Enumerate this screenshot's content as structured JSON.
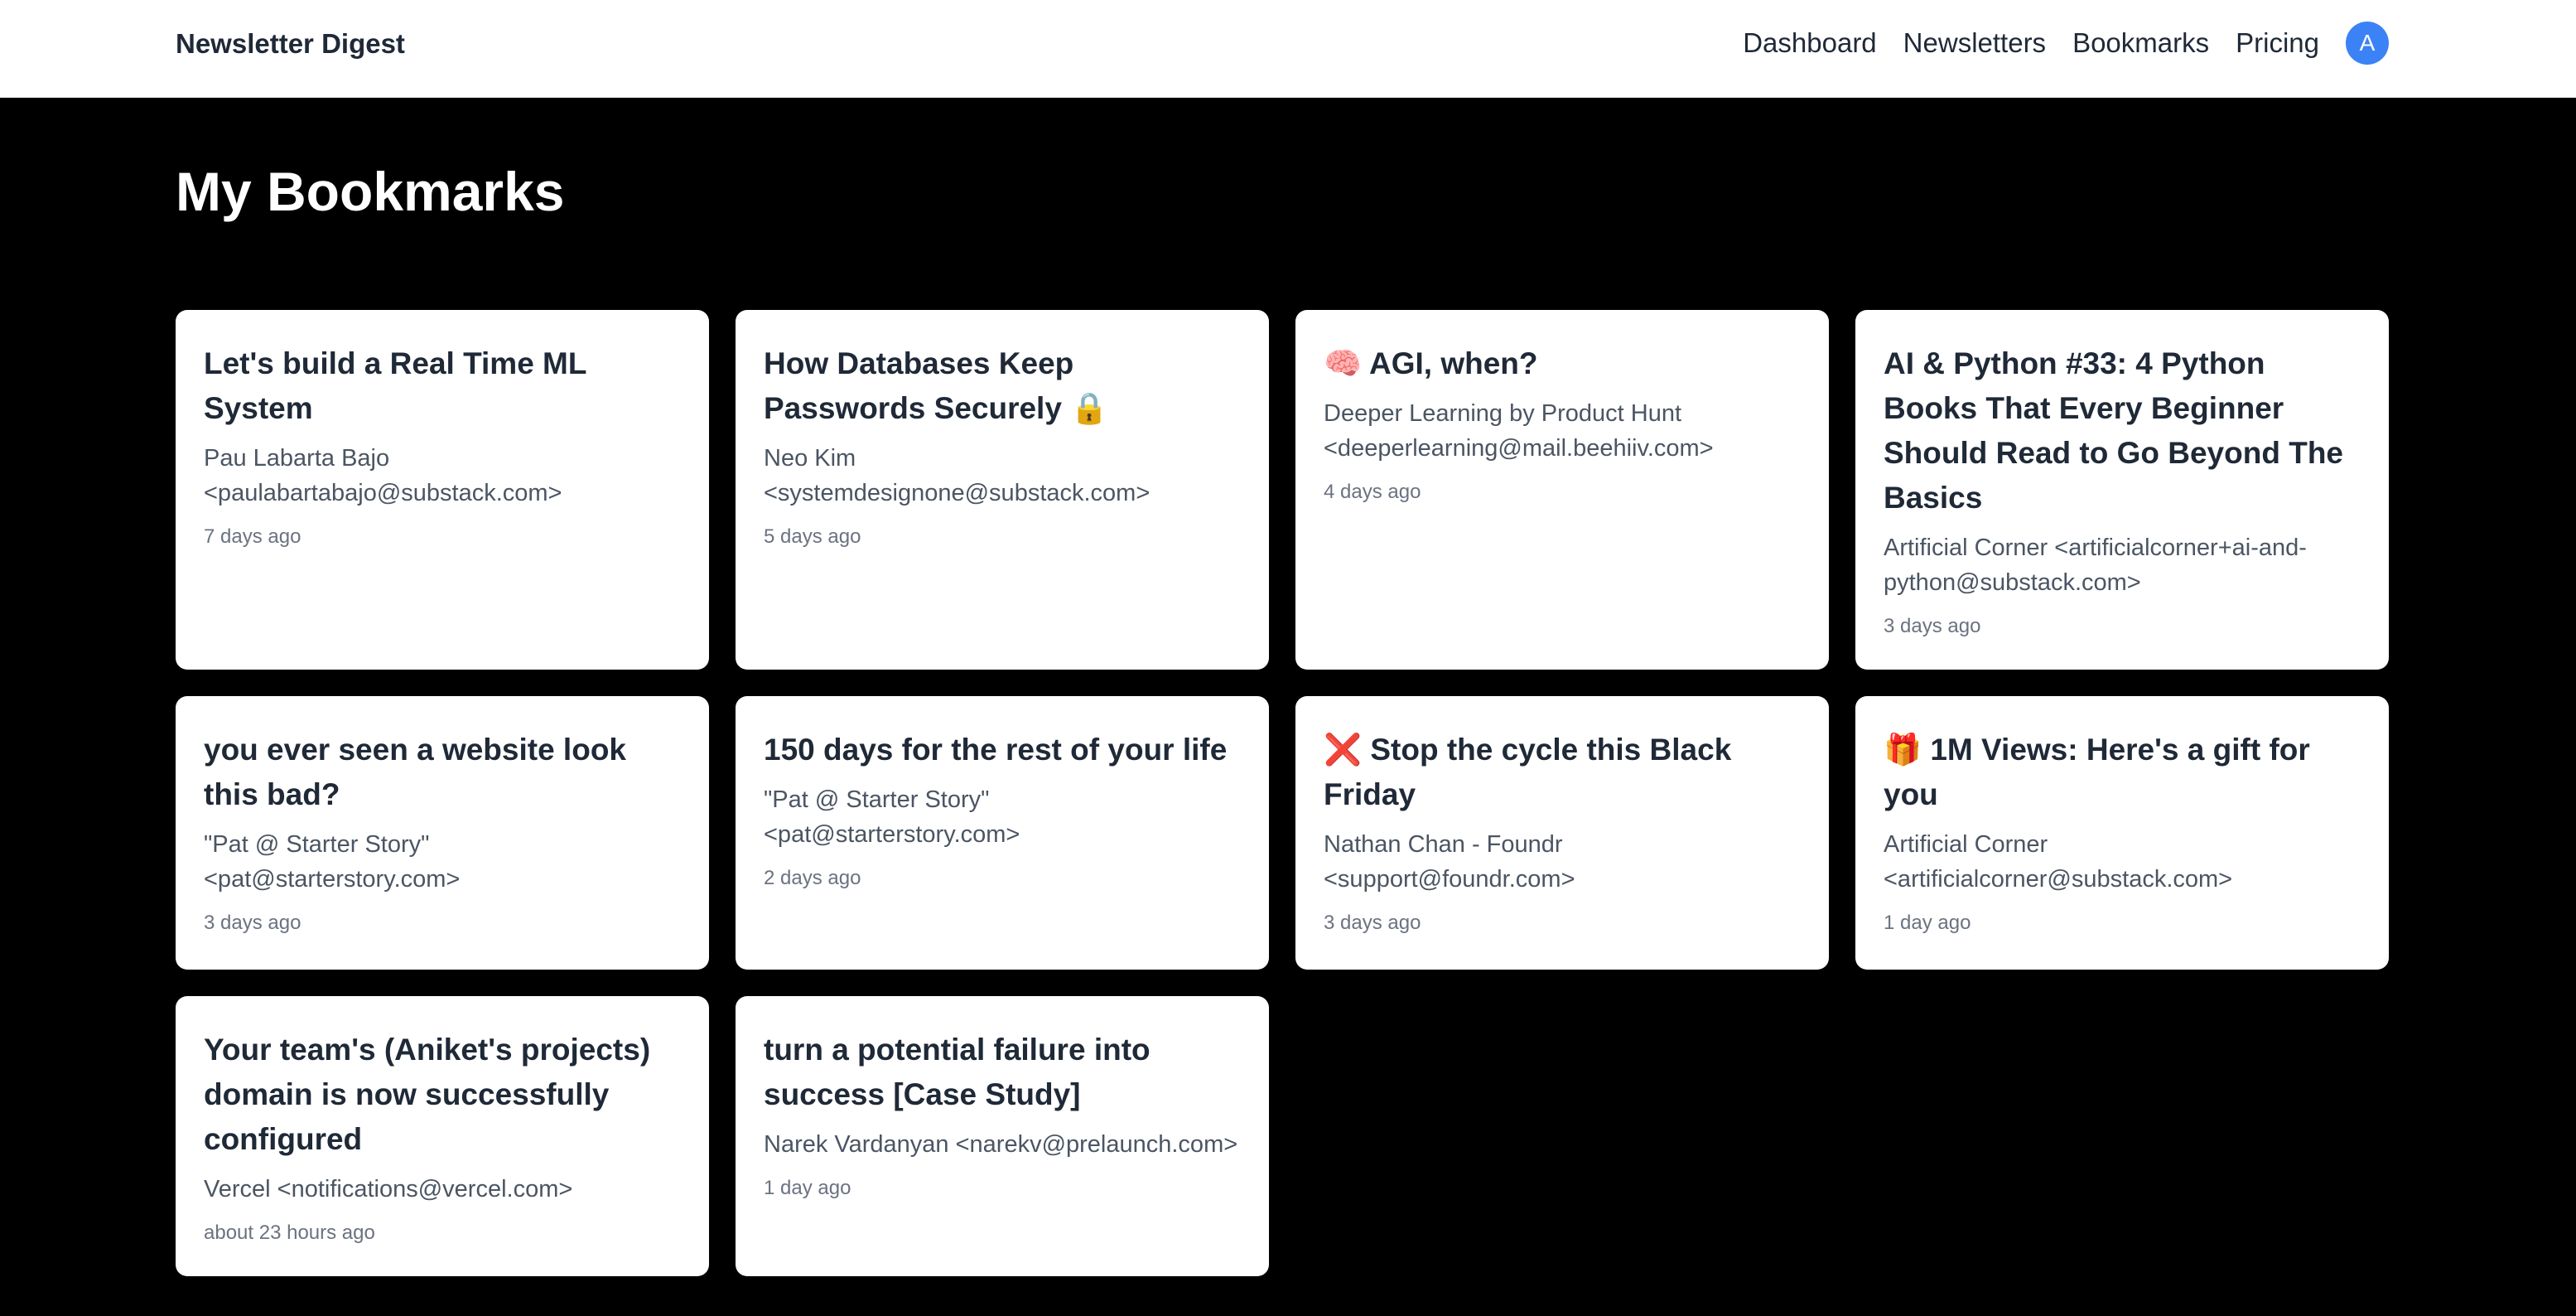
{
  "header": {
    "brand": "Newsletter Digest",
    "nav": [
      "Dashboard",
      "Newsletters",
      "Bookmarks",
      "Pricing"
    ],
    "avatar_letter": "A"
  },
  "page": {
    "title": "My Bookmarks"
  },
  "bookmarks": [
    {
      "title": "Let's build a Real Time ML System",
      "sender": "Pau Labarta Bajo <paulabartabajo@substack.com>",
      "time": "7 days ago"
    },
    {
      "title": "How Databases Keep Passwords Securely 🔒",
      "sender": "Neo Kim <systemdesignone@substack.com>",
      "time": "5 days ago"
    },
    {
      "title": "🧠 AGI, when?",
      "sender": "Deeper Learning by Product Hunt <deeperlearning@mail.beehiiv.com>",
      "time": "4 days ago"
    },
    {
      "title": "AI & Python #33: 4 Python Books That Every Beginner Should Read to Go Beyond The Basics",
      "sender": "Artificial Corner <artificialcorner+ai-and-python@substack.com>",
      "time": "3 days ago"
    },
    {
      "title": "you ever seen a website look this bad?",
      "sender": "\"Pat @ Starter Story\" <pat@starterstory.com>",
      "time": "3 days ago"
    },
    {
      "title": "150 days for the rest of your life",
      "sender": "\"Pat @ Starter Story\" <pat@starterstory.com>",
      "time": "2 days ago"
    },
    {
      "title": "❌ Stop the cycle this Black Friday",
      "sender": "Nathan Chan - Foundr <support@foundr.com>",
      "time": "3 days ago"
    },
    {
      "title": "🎁 1M Views: Here's a gift for you",
      "sender": "Artificial Corner <artificialcorner@substack.com>",
      "time": "1 day ago"
    },
    {
      "title": "Your team's (Aniket's projects) domain is now successfully configured",
      "sender": "Vercel <notifications@vercel.com>",
      "time": "about 23 hours ago"
    },
    {
      "title": "turn a potential failure into success [Case Study]",
      "sender": "Narek Vardanyan <narekv@prelaunch.com>",
      "time": "1 day ago"
    }
  ]
}
